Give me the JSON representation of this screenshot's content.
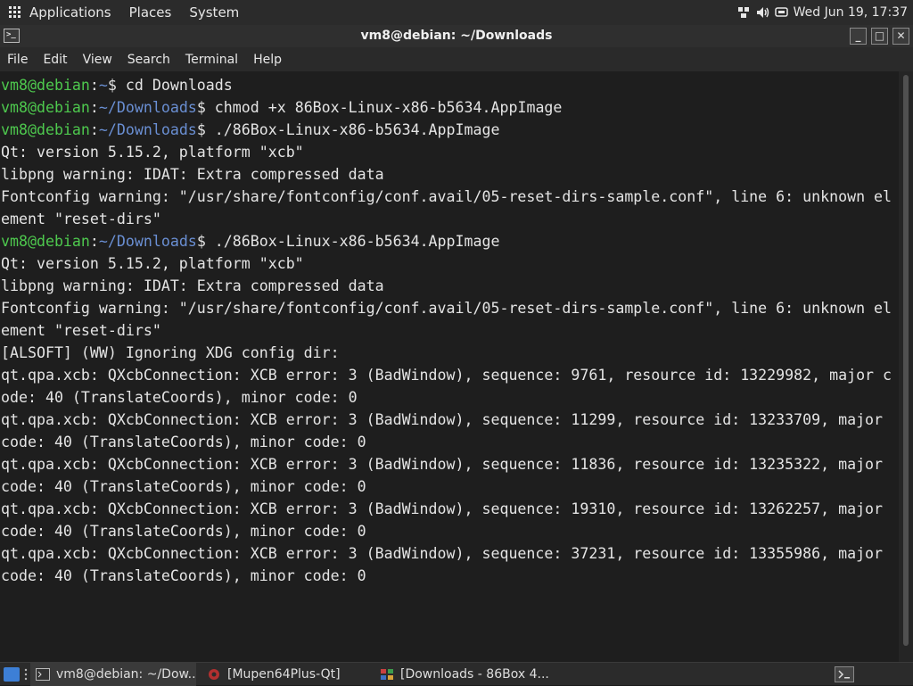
{
  "top_panel": {
    "menus": [
      "Applications",
      "Places",
      "System"
    ],
    "clock": "Wed Jun 19, 17:37",
    "tray_icons": [
      "network-icon",
      "volume-icon",
      "message-icon"
    ]
  },
  "window": {
    "title": "vm8@debian: ~/Downloads",
    "buttons": {
      "minimize": "_",
      "maximize": "□",
      "close": "✕"
    },
    "menu": [
      "File",
      "Edit",
      "View",
      "Search",
      "Terminal",
      "Help"
    ]
  },
  "terminal": {
    "lines": [
      [
        {
          "t": "vm8@debian",
          "c": "user"
        },
        {
          "t": ":",
          "c": "plain"
        },
        {
          "t": "~",
          "c": "path"
        },
        {
          "t": "$ cd Downloads",
          "c": "plain"
        }
      ],
      [
        {
          "t": "vm8@debian",
          "c": "user"
        },
        {
          "t": ":",
          "c": "plain"
        },
        {
          "t": "~/Downloads",
          "c": "path"
        },
        {
          "t": "$ chmod +x 86Box-Linux-x86-b5634.AppImage",
          "c": "plain"
        }
      ],
      [
        {
          "t": "vm8@debian",
          "c": "user"
        },
        {
          "t": ":",
          "c": "plain"
        },
        {
          "t": "~/Downloads",
          "c": "path"
        },
        {
          "t": "$ ./86Box-Linux-x86-b5634.AppImage",
          "c": "plain"
        }
      ],
      [
        {
          "t": "Qt: version 5.15.2, platform \"xcb\"",
          "c": "plain"
        }
      ],
      [
        {
          "t": "libpng warning: IDAT: Extra compressed data",
          "c": "plain"
        }
      ],
      [
        {
          "t": "Fontconfig warning: \"/usr/share/fontconfig/conf.avail/05-reset-dirs-sample.conf\", line 6: unknown el",
          "c": "plain"
        }
      ],
      [
        {
          "t": "ement \"reset-dirs\"",
          "c": "plain"
        }
      ],
      [
        {
          "t": "vm8@debian",
          "c": "user"
        },
        {
          "t": ":",
          "c": "plain"
        },
        {
          "t": "~/Downloads",
          "c": "path"
        },
        {
          "t": "$ ./86Box-Linux-x86-b5634.AppImage",
          "c": "plain"
        }
      ],
      [
        {
          "t": "Qt: version 5.15.2, platform \"xcb\"",
          "c": "plain"
        }
      ],
      [
        {
          "t": "libpng warning: IDAT: Extra compressed data",
          "c": "plain"
        }
      ],
      [
        {
          "t": "Fontconfig warning: \"/usr/share/fontconfig/conf.avail/05-reset-dirs-sample.conf\", line 6: unknown el",
          "c": "plain"
        }
      ],
      [
        {
          "t": "ement \"reset-dirs\"",
          "c": "plain"
        }
      ],
      [
        {
          "t": "[ALSOFT] (WW) Ignoring XDG config dir:",
          "c": "plain"
        }
      ],
      [
        {
          "t": "qt.qpa.xcb: QXcbConnection: XCB error: 3 (BadWindow), sequence: 9761, resource id: 13229982, major c",
          "c": "plain"
        }
      ],
      [
        {
          "t": "ode: 40 (TranslateCoords), minor code: 0",
          "c": "plain"
        }
      ],
      [
        {
          "t": "qt.qpa.xcb: QXcbConnection: XCB error: 3 (BadWindow), sequence: 11299, resource id: 13233709, major",
          "c": "plain"
        }
      ],
      [
        {
          "t": "code: 40 (TranslateCoords), minor code: 0",
          "c": "plain"
        }
      ],
      [
        {
          "t": "qt.qpa.xcb: QXcbConnection: XCB error: 3 (BadWindow), sequence: 11836, resource id: 13235322, major",
          "c": "plain"
        }
      ],
      [
        {
          "t": "code: 40 (TranslateCoords), minor code: 0",
          "c": "plain"
        }
      ],
      [
        {
          "t": "qt.qpa.xcb: QXcbConnection: XCB error: 3 (BadWindow), sequence: 19310, resource id: 13262257, major",
          "c": "plain"
        }
      ],
      [
        {
          "t": "code: 40 (TranslateCoords), minor code: 0",
          "c": "plain"
        }
      ],
      [
        {
          "t": "qt.qpa.xcb: QXcbConnection: XCB error: 3 (BadWindow), sequence: 37231, resource id: 13355986, major",
          "c": "plain"
        }
      ],
      [
        {
          "t": "code: 40 (TranslateCoords), minor code: 0",
          "c": "plain"
        }
      ]
    ]
  },
  "taskbar": {
    "tasks": [
      {
        "label": "vm8@debian: ~/Dow...",
        "icon": "terminal-icon",
        "active": true
      },
      {
        "label": "[Mupen64Plus-Qt]",
        "icon": "mupen-icon",
        "active": false
      },
      {
        "label": "[Downloads - 86Box 4...",
        "icon": "86box-icon",
        "active": false
      }
    ]
  },
  "colors": {
    "prompt_user": "#4ec94e",
    "prompt_path": "#6a8fd3",
    "text": "#e4e4e4",
    "background": "#1e1e1e"
  }
}
